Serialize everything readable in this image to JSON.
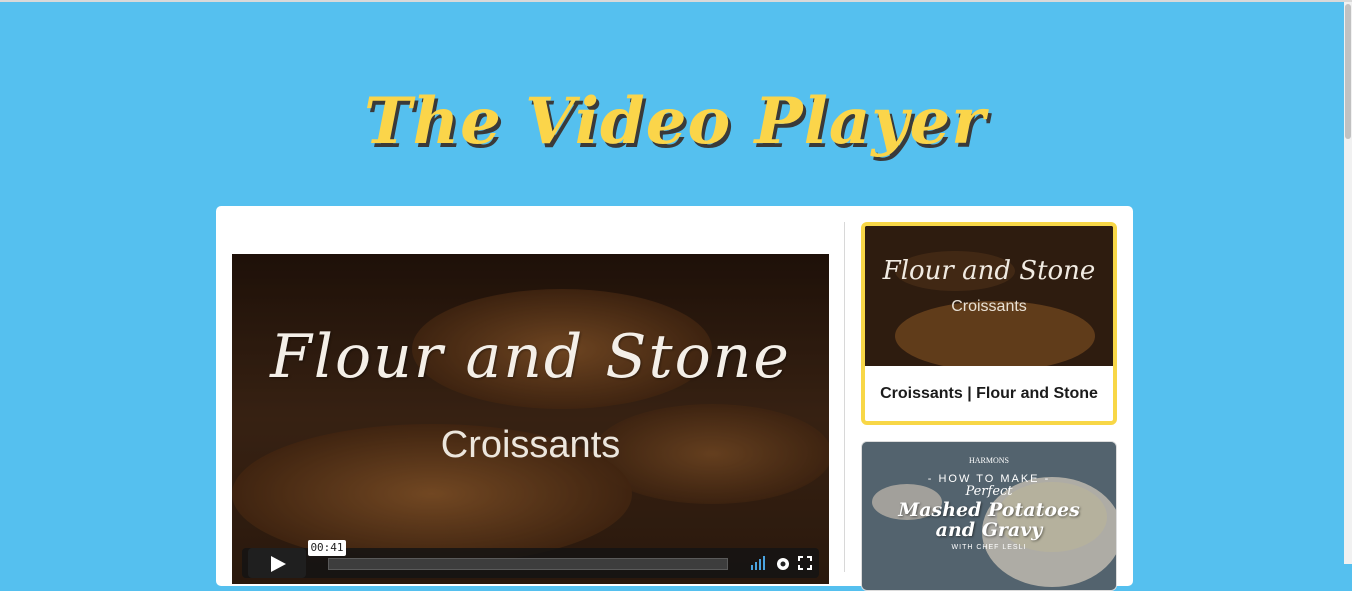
{
  "header": {
    "title": "The Video Player"
  },
  "player": {
    "video_script_title": "Flour and Stone",
    "video_subtitle": "Croissants",
    "time_tooltip": "00:41",
    "progress": 0.0
  },
  "playlist": {
    "items": [
      {
        "thumb_script": "Flour and Stone",
        "thumb_sub": "Croissants",
        "title": "Croissants | Flour and Stone",
        "active": true
      },
      {
        "brand": "HARMONS",
        "how": "- HOW TO MAKE -",
        "perfect": "Perfect",
        "main_line1": "Mashed Potatoes",
        "main_line2": "and Gravy",
        "chef": "WITH CHEF LESLI",
        "active": false
      }
    ]
  },
  "colors": {
    "background": "#55c0ef",
    "title": "#fbd54a",
    "active_border": "#f8d747",
    "card": "#ffffff"
  },
  "icons": [
    "play-icon",
    "volume-icon",
    "settings-icon",
    "fullscreen-icon"
  ]
}
